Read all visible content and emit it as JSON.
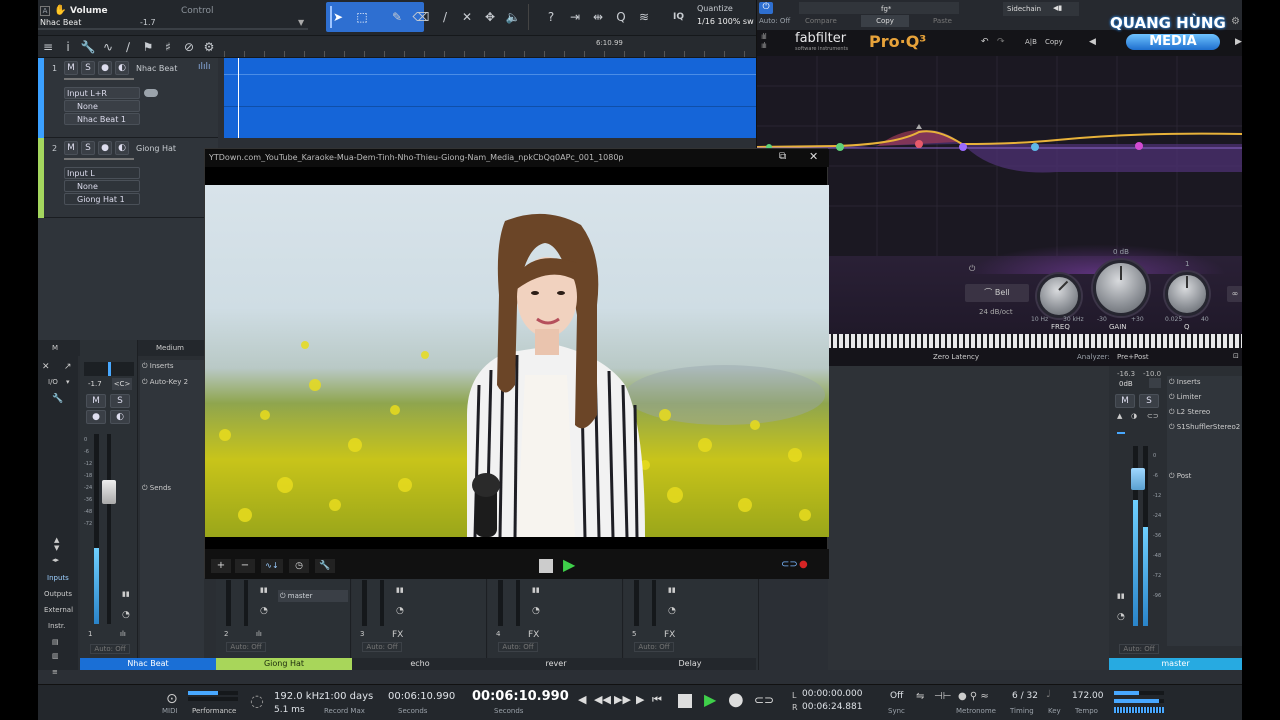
{
  "topbar": {
    "param_name": "Volume",
    "param_mode": "Control",
    "track_name": "Nhac Beat",
    "param_value": "-1.7",
    "quantize_label": "Quantize",
    "quantize_value": "1/16 100% sw",
    "iq_label": "IQ"
  },
  "ruler": {
    "time": "6:10.99"
  },
  "tracks": [
    {
      "num": "1",
      "name": "Nhac Beat",
      "input": "Input L+R",
      "send": "None",
      "output": "Nhac Beat  1",
      "color": "#3ba0ff"
    },
    {
      "num": "2",
      "name": "Giong Hat",
      "input": "Input L",
      "send": "None",
      "output": "Giong Hat  1",
      "color": "#a4d65e"
    }
  ],
  "track_buttons": {
    "m": "M",
    "s": "S"
  },
  "fabfilter": {
    "auto": "Auto: Off",
    "preset": "fg*",
    "compare": "Compare",
    "copy": "Copy",
    "paste": "Paste",
    "sidechain": "Sidechain",
    "brand": "fabfilter",
    "sub": "software instruments",
    "product": "Pro·Q³",
    "ab": "A|B",
    "copy2": "Copy",
    "bell": "Bell",
    "slope": "24 dB/oct",
    "freq_label": "FREQ",
    "gain_label": "GAIN",
    "q_label": "Q",
    "freq_min": "10 Hz",
    "freq_max": "30 kHz",
    "gain_min": "-30",
    "gain_max": "+30",
    "q_min": "0.025",
    "q_max": "40",
    "gain_top": "0 dB",
    "q_top": "1",
    "latency": "Zero Latency",
    "analyzer_label": "Analyzer:",
    "analyzer_value": "Pre+Post"
  },
  "video": {
    "title": "YTDown.com_YouTube_Karaoke-Mua-Dem-Tinh-Nho-Thieu-Giong-Nam_Media_npkCbQq0APc_001_1080p",
    "progress": 0.995
  },
  "logo": {
    "line1": "QUANG HÙNG",
    "line2": "MEDIA"
  },
  "mixer": {
    "tabs": {
      "m": "M",
      "s": "S",
      "size": "Medium"
    },
    "io": "I/O",
    "ch1_value": "-1.7",
    "ch1_pan": "<C>",
    "inserts": "Inserts",
    "insert1": "Auto-Key 2",
    "sends": "Sends",
    "send_master": "master",
    "side": [
      "Inputs",
      "Outputs",
      "External",
      "Instr."
    ],
    "auto_off": "Auto: Off",
    "scale": [
      "0",
      "-6",
      "-12",
      "-18",
      "-24",
      "-36",
      "-48",
      "-72"
    ],
    "channels": [
      {
        "num": "1",
        "name": "Nhac Beat",
        "tag": "",
        "color": "#1a6fd6"
      },
      {
        "num": "2",
        "name": "Giong Hat",
        "tag": "",
        "color": "#a8d65a"
      },
      {
        "num": "3",
        "name": "echo",
        "tag": "FX",
        "color": "#23272c"
      },
      {
        "num": "4",
        "name": "rever",
        "tag": "FX",
        "color": "#23272c"
      },
      {
        "num": "5",
        "name": "Delay",
        "tag": "FX",
        "color": "#23272c"
      }
    ],
    "master": {
      "name": "master",
      "mix_fx": "Mix FX",
      "peak_l": "-16.3",
      "peak_r": "-10.0",
      "gain": "0dB",
      "inserts": "Inserts",
      "plugins": [
        "Limiter",
        "L2 Stereo",
        "S1ShufflerStereo2"
      ],
      "post": "Post",
      "scale": [
        "0",
        "-6",
        "-12",
        "-24",
        "-36",
        "-48",
        "-72",
        "-96"
      ],
      "color": "#27aae1"
    }
  },
  "transport": {
    "midi": "MIDI",
    "performance": "Performance",
    "sample_rate": "192.0 kHz",
    "latency": "5.1 ms",
    "record_days": "1:00 days",
    "record_max": "Record Max",
    "seconds_val": "00:06:10.990",
    "seconds_label": "Seconds",
    "main_time": "00:06:10.990",
    "main_label": "Seconds",
    "loop_l": "00:00:00.000",
    "loop_r": "00:06:24.881",
    "l_label": "L",
    "r_label": "R",
    "sync_val": "Off",
    "sync_label": "Sync",
    "metronome": "Metronome",
    "timing_val": "6 / 32",
    "timing_label": "Timing",
    "key_label": "Key",
    "tempo_val": "172.00",
    "tempo_label": "Tempo"
  }
}
